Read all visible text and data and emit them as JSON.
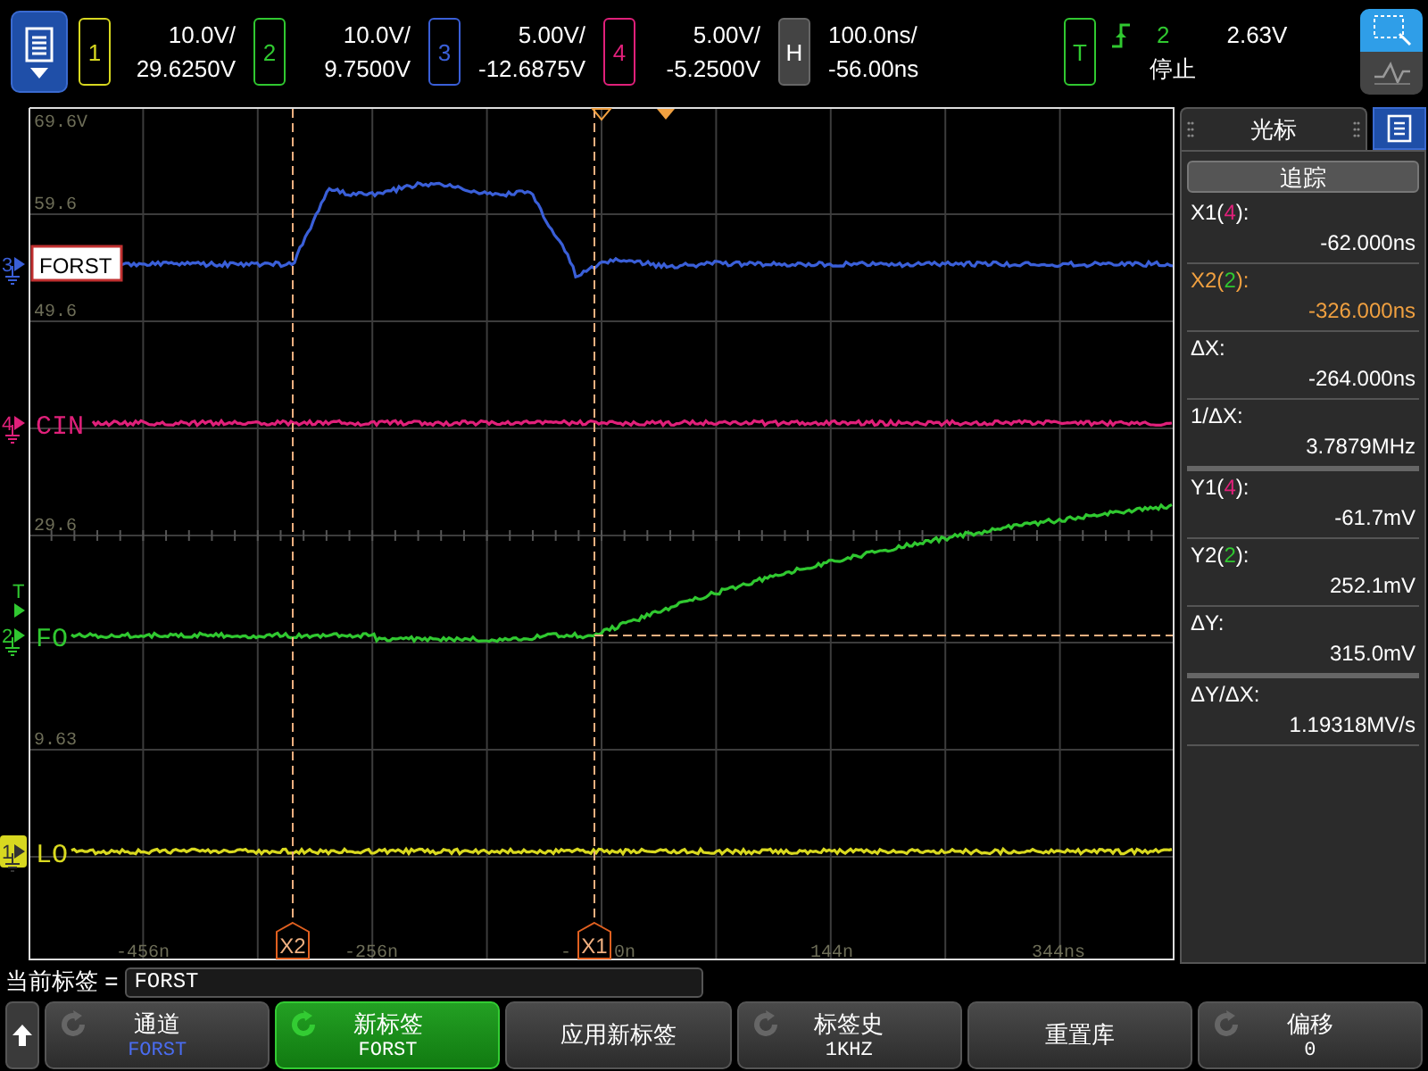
{
  "channels": [
    {
      "number": "1",
      "color": "#d8d820",
      "scale": "10.0V/",
      "offset": "29.6250V"
    },
    {
      "number": "2",
      "color": "#30c830",
      "scale": "10.0V/",
      "offset": "9.7500V"
    },
    {
      "number": "3",
      "color": "#3a5fd8",
      "scale": "5.00V/",
      "offset": "-12.6875V"
    },
    {
      "number": "4",
      "color": "#e0207a",
      "scale": "5.00V/",
      "offset": "-5.2500V"
    }
  ],
  "horizontal": {
    "letter": "H",
    "scale": "100.0ns/",
    "delay": "-56.00ns"
  },
  "trigger": {
    "letter": "T",
    "source": "2",
    "level": "2.63V",
    "status": "停止"
  },
  "touch_modes": [
    {
      "kind": "select",
      "selected": true
    },
    {
      "kind": "wave",
      "selected": false
    }
  ],
  "plot": {
    "y_labels": [
      "69.6V",
      "59.6",
      "49.6",
      "29.6",
      "9.63"
    ],
    "traces": [
      {
        "kind": "pulse",
        "marker": "3",
        "label": "FORST",
        "color": "#3a5fd8",
        "label_boxed": true,
        "marker_filled": false
      },
      {
        "kind": "flat_high",
        "marker": "4",
        "label": "CIN",
        "color": "#e0207a",
        "label_boxed": false,
        "marker_filled": false
      },
      {
        "kind": "rise",
        "marker": "2",
        "label": "FO",
        "color": "#30c830",
        "label_boxed": false,
        "marker_filled": false
      },
      {
        "kind": "flat_low",
        "marker": "1",
        "label": "LO",
        "color": "#d8d820",
        "label_boxed": false,
        "marker_filled": true
      }
    ],
    "trigger_marker": "T",
    "cursors": [
      "X2",
      "X1"
    ],
    "x_labels": [
      "-456n",
      "-256n",
      "-",
      "0n",
      "144n",
      "344ns"
    ]
  },
  "cursor_panel": {
    "tab": "光标",
    "mode_button": "追踪",
    "readouts": [
      {
        "label": "X1(",
        "source": {
          "text": "4",
          "color": "#e0207a"
        },
        "suffix": "):",
        "value": "-62.000ns",
        "active": false,
        "thick_divider": false
      },
      {
        "label": "X2(",
        "source": {
          "text": "2",
          "color": "#30c830"
        },
        "suffix": "):",
        "value": "-326.000ns",
        "active": true,
        "thick_divider": false
      },
      {
        "label": "ΔX:",
        "value": "-264.000ns",
        "active": false,
        "thick_divider": false
      },
      {
        "label": "1/ΔX:",
        "value": "3.7879MHz",
        "active": false,
        "thick_divider": true
      },
      {
        "label": "Y1(",
        "source": {
          "text": "4",
          "color": "#e0207a"
        },
        "suffix": "):",
        "value": "-61.7mV",
        "active": false,
        "thick_divider": false
      },
      {
        "label": "Y2(",
        "source": {
          "text": "2",
          "color": "#30c830"
        },
        "suffix": "):",
        "value": "252.1mV",
        "active": false,
        "thick_divider": false
      },
      {
        "label": "ΔY:",
        "value": "315.0mV",
        "active": false,
        "thick_divider": true
      },
      {
        "label": "ΔY/ΔX:",
        "value": "1.19318MV/s",
        "active": false,
        "thick_divider": false
      }
    ]
  },
  "label_line": {
    "caption": "当前标签 =",
    "value": "FORST"
  },
  "softkeys": [
    {
      "label": "通道",
      "value": "FORST",
      "value_color": {
        "color": "#4a6cf0"
      },
      "knob": true,
      "selected": false
    },
    {
      "label": "新标签",
      "value": "FORST",
      "knob": true,
      "selected": true
    },
    {
      "label": "应用新标签",
      "knob": false,
      "selected": false
    },
    {
      "label": "标签史",
      "value": "1KHZ",
      "knob": true,
      "selected": false
    },
    {
      "label": "重置库",
      "knob": false,
      "selected": false
    },
    {
      "label": "偏移",
      "value": "0",
      "knob": true,
      "selected": false
    }
  ]
}
